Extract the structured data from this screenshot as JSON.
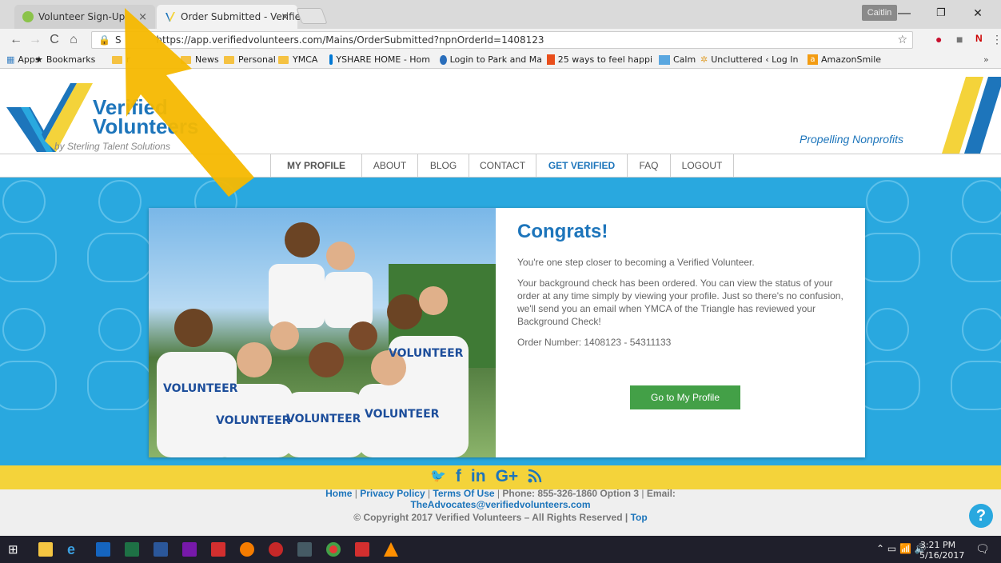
{
  "browser": {
    "tabs": [
      {
        "label": "Volunteer Sign-Up",
        "close": "×"
      },
      {
        "label": "Order Submitted - Verifie",
        "close": "×"
      }
    ],
    "user": "Caitlin",
    "window_controls": [
      "—",
      "❐",
      "✕"
    ],
    "url": "https://app.verifiedvolunteers.com/Mains/OrderSubmitted?npnOrderId=1408123",
    "url_prefix": "S",
    "nav": {
      "back": "←",
      "forward": "→",
      "reload": "C",
      "home": "⌂"
    },
    "star": "☆",
    "menu": "⋮",
    "bookmarks": [
      {
        "label": "Apps",
        "icon": "apps-grid-icon"
      },
      {
        "label": "Bookmarks",
        "icon": "star-icon"
      },
      {
        "label": "r",
        "icon": "folder-icon"
      },
      {
        "label": "News",
        "icon": "folder-icon"
      },
      {
        "label": "Personal",
        "icon": "folder-icon"
      },
      {
        "label": "YMCA",
        "icon": "folder-icon"
      },
      {
        "label": "YSHARE HOME - Hom",
        "icon": "sharepoint-icon"
      },
      {
        "label": "Login to Park and Ma",
        "icon": "park-icon"
      },
      {
        "label": "25 ways to feel happi",
        "icon": "sun-icon"
      },
      {
        "label": "Calm",
        "icon": "calm-icon"
      },
      {
        "label": "Uncluttered ‹ Log In",
        "icon": "uncluttered-icon"
      },
      {
        "label": "AmazonSmile",
        "icon": "amazon-icon"
      }
    ],
    "bookmarks_more": "»"
  },
  "site": {
    "logo_line1": "Verified",
    "logo_line2": "Volunteers",
    "logo_sub": "by Sterling Talent Solutions",
    "tagline": "Propelling Nonprofits",
    "nav": [
      "MY PROFILE",
      "ABOUT",
      "BLOG",
      "CONTACT",
      "GET VERIFIED",
      "FAQ",
      "LOGOUT"
    ],
    "active_nav": "GET VERIFIED"
  },
  "main": {
    "heading": "Congrats!",
    "intro": "You're one step closer to becoming a Verified Volunteer.",
    "body": "Your background check has been ordered. You can view the status of your order at any time simply by viewing your profile. Just so there's no confusion, we'll send you an email when YMCA of the Triangle has reviewed your Background Check!",
    "order_number": "Order Number: 1408123 - 54311133",
    "button_label": "Go to My Profile",
    "photo_shirt_text": "VOLUNTEER"
  },
  "footer": {
    "social": [
      "twitter-icon",
      "facebook-icon",
      "linkedin-icon",
      "googleplus-icon",
      "rss-icon"
    ],
    "social_glyphs": [
      "🐦",
      "f",
      "in",
      "G+",
      "☰"
    ],
    "links": [
      "Home",
      "Privacy Policy",
      "Terms Of Use"
    ],
    "phone": "Phone: 855-326-1860 Option 3",
    "email_label": "Email:",
    "email": "TheAdvocates@verifiedvolunteers.com",
    "copyright": "© Copyright 2017 Verified Volunteers – All Rights Reserved |",
    "top_link": "Top",
    "help": "?"
  },
  "taskbar": {
    "time": "3:21 PM",
    "date": "5/16/2017",
    "apps": [
      "start",
      "file-explorer",
      "internet-explorer",
      "outlook",
      "excel",
      "word",
      "onenote",
      "pdf",
      "chrome-canary",
      "shield",
      "remote",
      "chrome",
      "pdf-reader",
      "vlc"
    ]
  },
  "colors": {
    "accent": "#1d75bb",
    "hero_bg": "#29a8df",
    "button": "#43a047",
    "footer_band": "#f4d33a",
    "arrow": "#f5b800"
  }
}
